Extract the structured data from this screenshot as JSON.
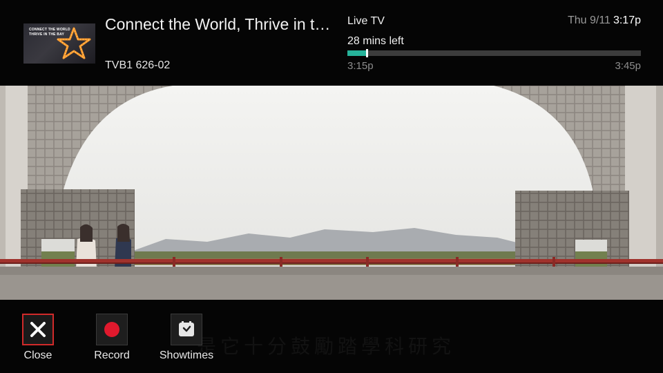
{
  "program": {
    "title": "Connect the World, Thrive in t…",
    "channel": "TVB1 626-02",
    "thumbnail_text_line1": "CONNECT THE WORLD",
    "thumbnail_text_line2": "THRIVE IN THE BAY"
  },
  "live": {
    "label": "Live TV",
    "time_left": "28 mins left",
    "start": "3:15p",
    "end": "3:45p",
    "progress_fraction": 0.067
  },
  "clock": {
    "date": "Thu 9/11",
    "time": "3:17p"
  },
  "subtitle": "是它十分鼓勵踏學科研究",
  "actions": {
    "close_label": "Close",
    "record_label": "Record",
    "showtimes_label": "Showtimes"
  },
  "colors": {
    "accent_progress": "#26b39a",
    "focus_border": "#d22a2a",
    "record_dot": "#e0192d"
  },
  "icons": {
    "close": "close-x-icon",
    "record": "record-dot-icon",
    "showtimes": "clock-calendar-icon",
    "thumbnail_star": "marquee-star-icon"
  }
}
